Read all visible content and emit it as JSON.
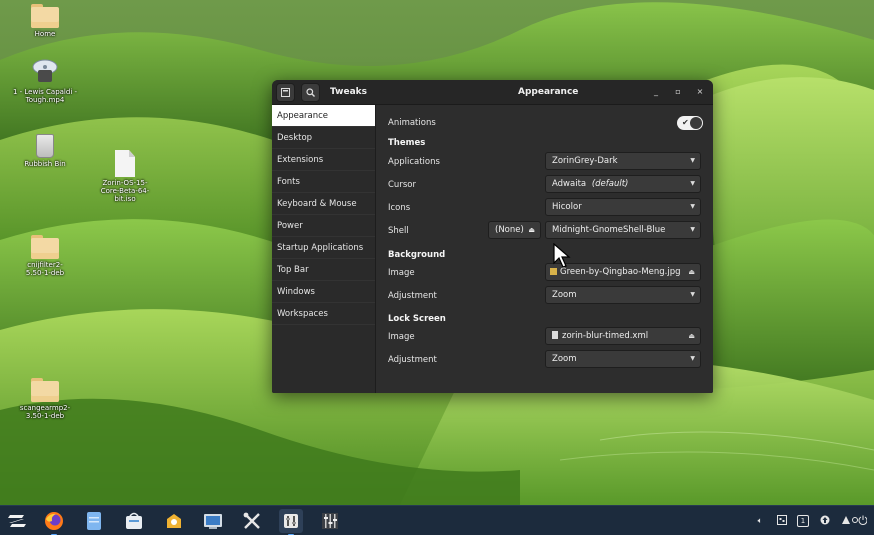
{
  "desktop": {
    "icons": [
      {
        "label": "Home",
        "kind": "folder-icon"
      },
      {
        "label": "1 - Lewis Capaldi - Tough.mp4",
        "kind": "video-disc-icon"
      },
      {
        "label": "Rubbish Bin",
        "kind": "trash-icon"
      },
      {
        "label": "Zorin-OS-15-Core-Beta-64-bit.iso",
        "kind": "file-icon"
      },
      {
        "label": "cnijfilter2-5.50-1-deb",
        "kind": "folder-icon"
      },
      {
        "label": "scangearmp2-3.50-1-deb",
        "kind": "folder-icon"
      }
    ]
  },
  "window": {
    "app_title": "Tweaks",
    "page_title": "Appearance",
    "controls": {
      "minimize": "_",
      "maximize": "▫",
      "close": "×"
    }
  },
  "sidebar": {
    "items": [
      {
        "label": "Appearance",
        "active": true
      },
      {
        "label": "Desktop",
        "active": false
      },
      {
        "label": "Extensions",
        "active": false
      },
      {
        "label": "Fonts",
        "active": false
      },
      {
        "label": "Keyboard & Mouse",
        "active": false
      },
      {
        "label": "Power",
        "active": false
      },
      {
        "label": "Startup Applications",
        "active": false
      },
      {
        "label": "Top Bar",
        "active": false
      },
      {
        "label": "Windows",
        "active": false
      },
      {
        "label": "Workspaces",
        "active": false
      }
    ]
  },
  "content": {
    "animations_label": "Animations",
    "animations_on": true,
    "themes": {
      "heading": "Themes",
      "applications_label": "Applications",
      "applications_value": "ZorinGrey-Dark",
      "cursor_label": "Cursor",
      "cursor_value": "Adwaita",
      "cursor_value_suffix": "(default)",
      "icons_label": "Icons",
      "icons_value": "Hicolor",
      "shell_label": "Shell",
      "shell_none_label": "(None)",
      "shell_value": "Midnight-GnomeShell-Blue"
    },
    "background": {
      "heading": "Background",
      "image_label": "Image",
      "image_value": "Green-by-Qingbao-Meng.jpg",
      "adjustment_label": "Adjustment",
      "adjustment_value": "Zoom"
    },
    "lock_screen": {
      "heading": "Lock Screen",
      "image_label": "Image",
      "image_value": "zorin-blur-timed.xml",
      "adjustment_label": "Adjustment",
      "adjustment_value": "Zoom"
    }
  },
  "taskbar": {
    "apps": [
      "zorin-menu-icon",
      "firefox-icon",
      "files-icon",
      "software-store-icon",
      "ubuntu-software-icon",
      "screenshot-icon",
      "tweaks-icon",
      "terminal-icon",
      "mixer-icon"
    ],
    "tray": {
      "workspace": "1"
    }
  },
  "colors": {
    "window_bg": "#2d2d2d",
    "sidebar_active_bg": "#ffffff",
    "taskbar_bg": "#1c2b3d",
    "accent": "#59a8ff"
  }
}
